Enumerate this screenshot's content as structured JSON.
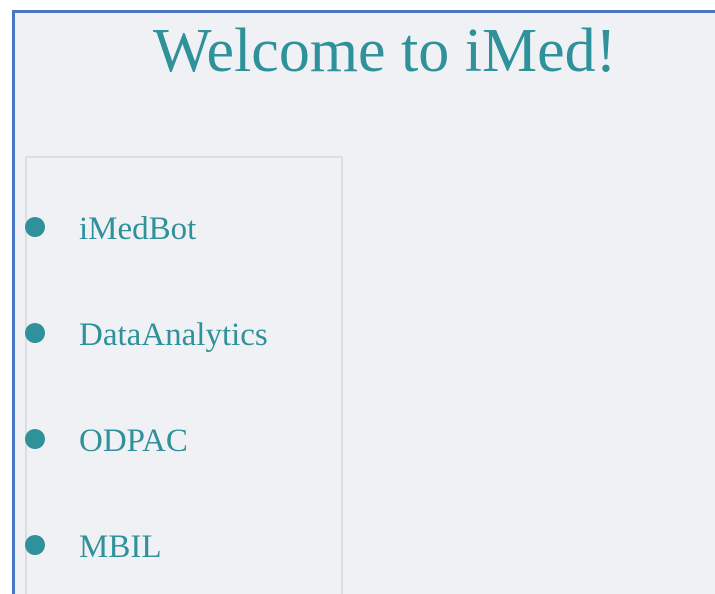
{
  "page": {
    "title": "Welcome to iMed!"
  },
  "nav": {
    "items": [
      {
        "label": "iMedBot",
        "icon": "bullet-dot"
      },
      {
        "label": "DataAnalytics",
        "icon": "bullet-dot"
      },
      {
        "label": "ODPAC",
        "icon": "bullet-dot"
      },
      {
        "label": "MBIL",
        "icon": "bullet-dot"
      }
    ]
  },
  "colors": {
    "accent": "#2f9199",
    "background": "#f0f1f5",
    "frame_border": "#4a76c5",
    "panel_border": "#dcdde2"
  }
}
